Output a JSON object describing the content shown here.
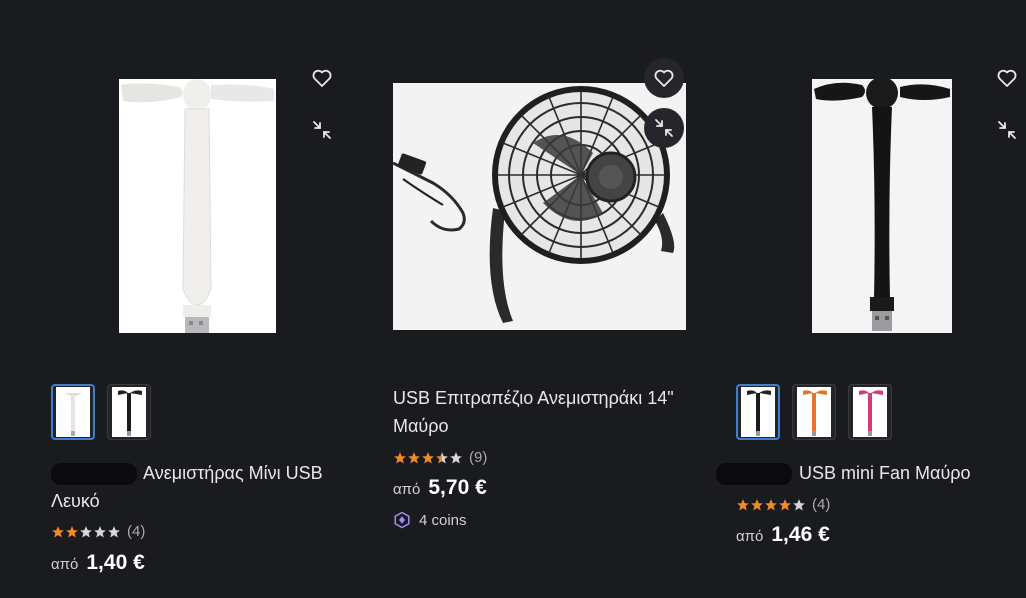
{
  "colors": {
    "background": "#1a1b1f",
    "star": "#f08a24",
    "accent": "#3f7fd0"
  },
  "products": [
    {
      "image_icon": "usb-mini-fan-white-image",
      "title_visible": "Ανεμιστήρας Μίνι USB Λευκό",
      "rating": 2,
      "reviews": "(4)",
      "price_prefix": "από",
      "price": "1,40 €",
      "thumbnails": [
        "white",
        "black"
      ]
    },
    {
      "image_icon": "usb-desk-fan-black-image",
      "title_visible": "USB Επιτραπέζιο Ανεμιστηράκι 14\" Μαύρο",
      "rating": 3.5,
      "reviews": "(9)",
      "price_prefix": "από",
      "price": "5,70 €",
      "coins": "4 coins"
    },
    {
      "image_icon": "usb-mini-fan-black-image",
      "title_visible": "USB mini Fan Μαύρο",
      "rating": 4,
      "reviews": "(4)",
      "price_prefix": "από",
      "price": "1,46 €",
      "thumbnails": [
        "black",
        "orange",
        "pink"
      ]
    }
  ],
  "icons": {
    "favorite": "heart-icon",
    "compare": "compress-arrows-icon",
    "coins": "coin-hexagon-icon",
    "rating": "star-icon"
  }
}
